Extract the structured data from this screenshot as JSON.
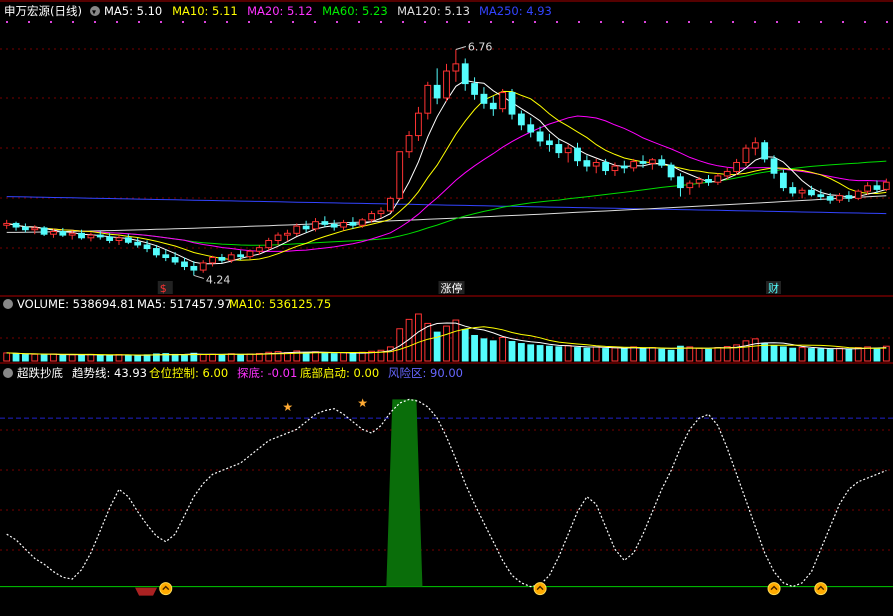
{
  "colors": {
    "bg": "#000000",
    "up": "#ff3333",
    "down": "#54fcfc",
    "ma5": "#ffffff",
    "ma10": "#ffff00",
    "ma20": "#ff00ff",
    "ma60": "#00dd00",
    "ma120": "#dddddd",
    "ma250": "#3344ff",
    "divider": "#aa0000",
    "grid": "#770000",
    "trend": "#ffffff",
    "position": "#00aa00",
    "bottom": "#00cc00",
    "explore": "#aa2222",
    "risk": "#2222cc",
    "label_trend": "#ffffff",
    "label_position": "#ffff00",
    "label_explore": "#ff33ff",
    "label_launch": "#ffff00",
    "label_risk": "#6666ff"
  },
  "price_panel": {
    "title": "申万宏源(日线)",
    "legend": [
      {
        "key": "ma5",
        "label": "MA5: 5.10",
        "color": "#ffffff"
      },
      {
        "key": "ma10",
        "label": "MA10: 5.11",
        "color": "#ffff00"
      },
      {
        "key": "ma20",
        "label": "MA20: 5.12",
        "color": "#ff33ff"
      },
      {
        "key": "ma60",
        "label": "MA60: 5.23",
        "color": "#00ee00"
      },
      {
        "key": "ma120",
        "label": "MA120: 5.13",
        "color": "#dddddd"
      },
      {
        "key": "ma250",
        "label": "MA250: 4.93",
        "color": "#3344ff"
      }
    ],
    "high_label": "6.76",
    "low_label": "4.24",
    "markers": [
      {
        "text": "$",
        "color": "#ff3333"
      },
      {
        "text": "涨停",
        "color": "#ffffff"
      },
      {
        "text": "财",
        "color": "#54fcfc"
      }
    ]
  },
  "volume_panel": {
    "title": "VOLUME: 538694.81",
    "ma5": "MA5: 517457.97",
    "ma10": "MA10: 536125.75"
  },
  "indicator_panel": {
    "title": "超跌抄底",
    "trend": "趋势线: 43.93",
    "position": "仓位控制: 6.00",
    "explore": "探底: -0.01",
    "launch": "底部启动: 0.00",
    "risk": "风险区: 90.00"
  },
  "chart_data": [
    {
      "type": "candlestick",
      "title": "申万宏源(日线)",
      "ylim": [
        4.1,
        7.0
      ],
      "ohlc": [
        [
          4.8,
          4.86,
          4.76,
          4.82
        ],
        [
          4.82,
          4.84,
          4.74,
          4.78
        ],
        [
          4.78,
          4.82,
          4.72,
          4.75
        ],
        [
          4.75,
          4.8,
          4.7,
          4.77
        ],
        [
          4.77,
          4.79,
          4.68,
          4.7
        ],
        [
          4.7,
          4.76,
          4.66,
          4.73
        ],
        [
          4.73,
          4.77,
          4.67,
          4.69
        ],
        [
          4.69,
          4.74,
          4.64,
          4.71
        ],
        [
          4.71,
          4.75,
          4.64,
          4.66
        ],
        [
          4.66,
          4.72,
          4.62,
          4.69
        ],
        [
          4.69,
          4.74,
          4.64,
          4.67
        ],
        [
          4.67,
          4.71,
          4.6,
          4.63
        ],
        [
          4.63,
          4.69,
          4.58,
          4.66
        ],
        [
          4.66,
          4.7,
          4.59,
          4.61
        ],
        [
          4.61,
          4.66,
          4.55,
          4.58
        ],
        [
          4.58,
          4.63,
          4.5,
          4.54
        ],
        [
          4.54,
          4.58,
          4.44,
          4.47
        ],
        [
          4.47,
          4.53,
          4.4,
          4.44
        ],
        [
          4.44,
          4.5,
          4.36,
          4.39
        ],
        [
          4.39,
          4.44,
          4.3,
          4.34
        ],
        [
          4.34,
          4.4,
          4.24,
          4.3
        ],
        [
          4.3,
          4.41,
          4.27,
          4.38
        ],
        [
          4.38,
          4.46,
          4.34,
          4.44
        ],
        [
          4.44,
          4.48,
          4.38,
          4.41
        ],
        [
          4.41,
          4.5,
          4.38,
          4.47
        ],
        [
          4.47,
          4.52,
          4.41,
          4.45
        ],
        [
          4.45,
          4.53,
          4.42,
          4.51
        ],
        [
          4.51,
          4.58,
          4.47,
          4.55
        ],
        [
          4.55,
          4.66,
          4.52,
          4.63
        ],
        [
          4.63,
          4.72,
          4.58,
          4.69
        ],
        [
          4.69,
          4.75,
          4.62,
          4.71
        ],
        [
          4.71,
          4.82,
          4.68,
          4.79
        ],
        [
          4.79,
          4.85,
          4.72,
          4.76
        ],
        [
          4.76,
          4.88,
          4.73,
          4.84
        ],
        [
          4.84,
          4.9,
          4.78,
          4.81
        ],
        [
          4.81,
          4.86,
          4.74,
          4.78
        ],
        [
          4.78,
          4.86,
          4.74,
          4.83
        ],
        [
          4.83,
          4.89,
          4.76,
          4.8
        ],
        [
          4.8,
          4.88,
          4.77,
          4.86
        ],
        [
          4.86,
          4.96,
          4.83,
          4.93
        ],
        [
          4.93,
          5.0,
          4.88,
          4.96
        ],
        [
          4.96,
          5.12,
          4.94,
          5.1
        ],
        [
          5.1,
          5.62,
          5.08,
          5.62
        ],
        [
          5.62,
          5.85,
          5.55,
          5.8
        ],
        [
          5.8,
          6.12,
          5.74,
          6.05
        ],
        [
          6.05,
          6.4,
          5.98,
          6.36
        ],
        [
          6.36,
          6.55,
          6.15,
          6.22
        ],
        [
          6.22,
          6.6,
          6.18,
          6.52
        ],
        [
          6.52,
          6.76,
          6.4,
          6.6
        ],
        [
          6.6,
          6.66,
          6.3,
          6.38
        ],
        [
          6.38,
          6.45,
          6.2,
          6.26
        ],
        [
          6.26,
          6.34,
          6.1,
          6.16
        ],
        [
          6.16,
          6.24,
          6.02,
          6.1
        ],
        [
          6.1,
          6.32,
          6.06,
          6.28
        ],
        [
          6.28,
          6.32,
          5.98,
          6.04
        ],
        [
          6.04,
          6.08,
          5.86,
          5.92
        ],
        [
          5.92,
          6.0,
          5.78,
          5.84
        ],
        [
          5.84,
          5.9,
          5.68,
          5.74
        ],
        [
          5.74,
          5.82,
          5.62,
          5.7
        ],
        [
          5.7,
          5.76,
          5.55,
          5.61
        ],
        [
          5.61,
          5.7,
          5.5,
          5.66
        ],
        [
          5.66,
          5.72,
          5.46,
          5.52
        ],
        [
          5.52,
          5.58,
          5.4,
          5.46
        ],
        [
          5.46,
          5.54,
          5.38,
          5.5
        ],
        [
          5.5,
          5.54,
          5.36,
          5.41
        ],
        [
          5.41,
          5.5,
          5.35,
          5.46
        ],
        [
          5.46,
          5.52,
          5.38,
          5.44
        ],
        [
          5.44,
          5.54,
          5.4,
          5.51
        ],
        [
          5.51,
          5.58,
          5.44,
          5.49
        ],
        [
          5.49,
          5.55,
          5.42,
          5.53
        ],
        [
          5.53,
          5.58,
          5.44,
          5.47
        ],
        [
          5.47,
          5.5,
          5.3,
          5.34
        ],
        [
          5.34,
          5.38,
          5.12,
          5.22
        ],
        [
          5.22,
          5.3,
          5.14,
          5.27
        ],
        [
          5.27,
          5.34,
          5.22,
          5.31
        ],
        [
          5.31,
          5.36,
          5.24,
          5.28
        ],
        [
          5.28,
          5.38,
          5.25,
          5.35
        ],
        [
          5.35,
          5.44,
          5.31,
          5.4
        ],
        [
          5.4,
          5.54,
          5.36,
          5.5
        ],
        [
          5.5,
          5.7,
          5.46,
          5.66
        ],
        [
          5.66,
          5.78,
          5.58,
          5.72
        ],
        [
          5.72,
          5.75,
          5.5,
          5.54
        ],
        [
          5.54,
          5.58,
          5.32,
          5.38
        ],
        [
          5.38,
          5.42,
          5.18,
          5.22
        ],
        [
          5.22,
          5.28,
          5.12,
          5.16
        ],
        [
          5.16,
          5.22,
          5.1,
          5.19
        ],
        [
          5.19,
          5.24,
          5.12,
          5.14
        ],
        [
          5.14,
          5.2,
          5.08,
          5.12
        ],
        [
          5.12,
          5.16,
          5.04,
          5.08
        ],
        [
          5.08,
          5.16,
          5.05,
          5.13
        ],
        [
          5.13,
          5.18,
          5.06,
          5.1
        ],
        [
          5.1,
          5.2,
          5.08,
          5.18
        ],
        [
          5.18,
          5.28,
          5.14,
          5.24
        ],
        [
          5.24,
          5.3,
          5.16,
          5.2
        ],
        [
          5.2,
          5.32,
          5.18,
          5.28
        ]
      ],
      "ma5_last": 5.1,
      "ma10_last": 5.11,
      "ma20_last": 5.12,
      "ma60_last": 5.23,
      "ma120_last": 5.13,
      "ma250_last": 4.93,
      "high": 6.76,
      "low": 4.24
    },
    {
      "type": "bar",
      "title": "VOLUME",
      "values": [
        120,
        110,
        95,
        100,
        90,
        105,
        88,
        92,
        85,
        98,
        90,
        82,
        95,
        86,
        80,
        92,
        105,
        110,
        98,
        90,
        115,
        96,
        100,
        92,
        108,
        95,
        104,
        112,
        130,
        140,
        125,
        150,
        120,
        138,
        115,
        110,
        124,
        112,
        130,
        145,
        160,
        210,
        480,
        620,
        700,
        560,
        430,
        520,
        610,
        470,
        380,
        330,
        300,
        350,
        290,
        260,
        240,
        230,
        220,
        210,
        230,
        200,
        190,
        210,
        185,
        195,
        180,
        210,
        190,
        200,
        175,
        160,
        220,
        210,
        190,
        175,
        200,
        215,
        240,
        300,
        330,
        260,
        230,
        210,
        190,
        200,
        185,
        180,
        170,
        190,
        175,
        200,
        210,
        190,
        220
      ],
      "last": 538694.81,
      "ma5_last": 517457.97,
      "ma10_last": 536125.75
    },
    {
      "type": "line",
      "title": "超跌抄底",
      "ylim": [
        -5,
        105
      ],
      "trend": [
        28,
        25,
        20,
        15,
        12,
        8,
        5,
        4,
        9,
        18,
        30,
        42,
        52,
        48,
        40,
        33,
        27,
        24,
        28,
        38,
        48,
        55,
        60,
        62,
        64,
        66,
        70,
        74,
        78,
        80,
        82,
        84,
        88,
        92,
        94,
        95,
        92,
        88,
        84,
        82,
        86,
        93,
        98,
        100,
        99,
        96,
        90,
        80,
        68,
        55,
        44,
        34,
        24,
        14,
        6,
        2,
        0,
        1,
        6,
        16,
        28,
        40,
        48,
        44,
        32,
        20,
        14,
        18,
        28,
        40,
        52,
        62,
        74,
        84,
        90,
        92,
        86,
        74,
        60,
        46,
        32,
        18,
        8,
        2,
        0,
        2,
        8,
        20,
        32,
        44,
        52,
        56,
        58,
        60,
        62
      ],
      "position_span": [
        41,
        44
      ],
      "trend_last": 43.93,
      "position_last": 6.0,
      "explore_last": -0.01,
      "launch_last": 0.0,
      "risk_last": 90.0
    }
  ]
}
